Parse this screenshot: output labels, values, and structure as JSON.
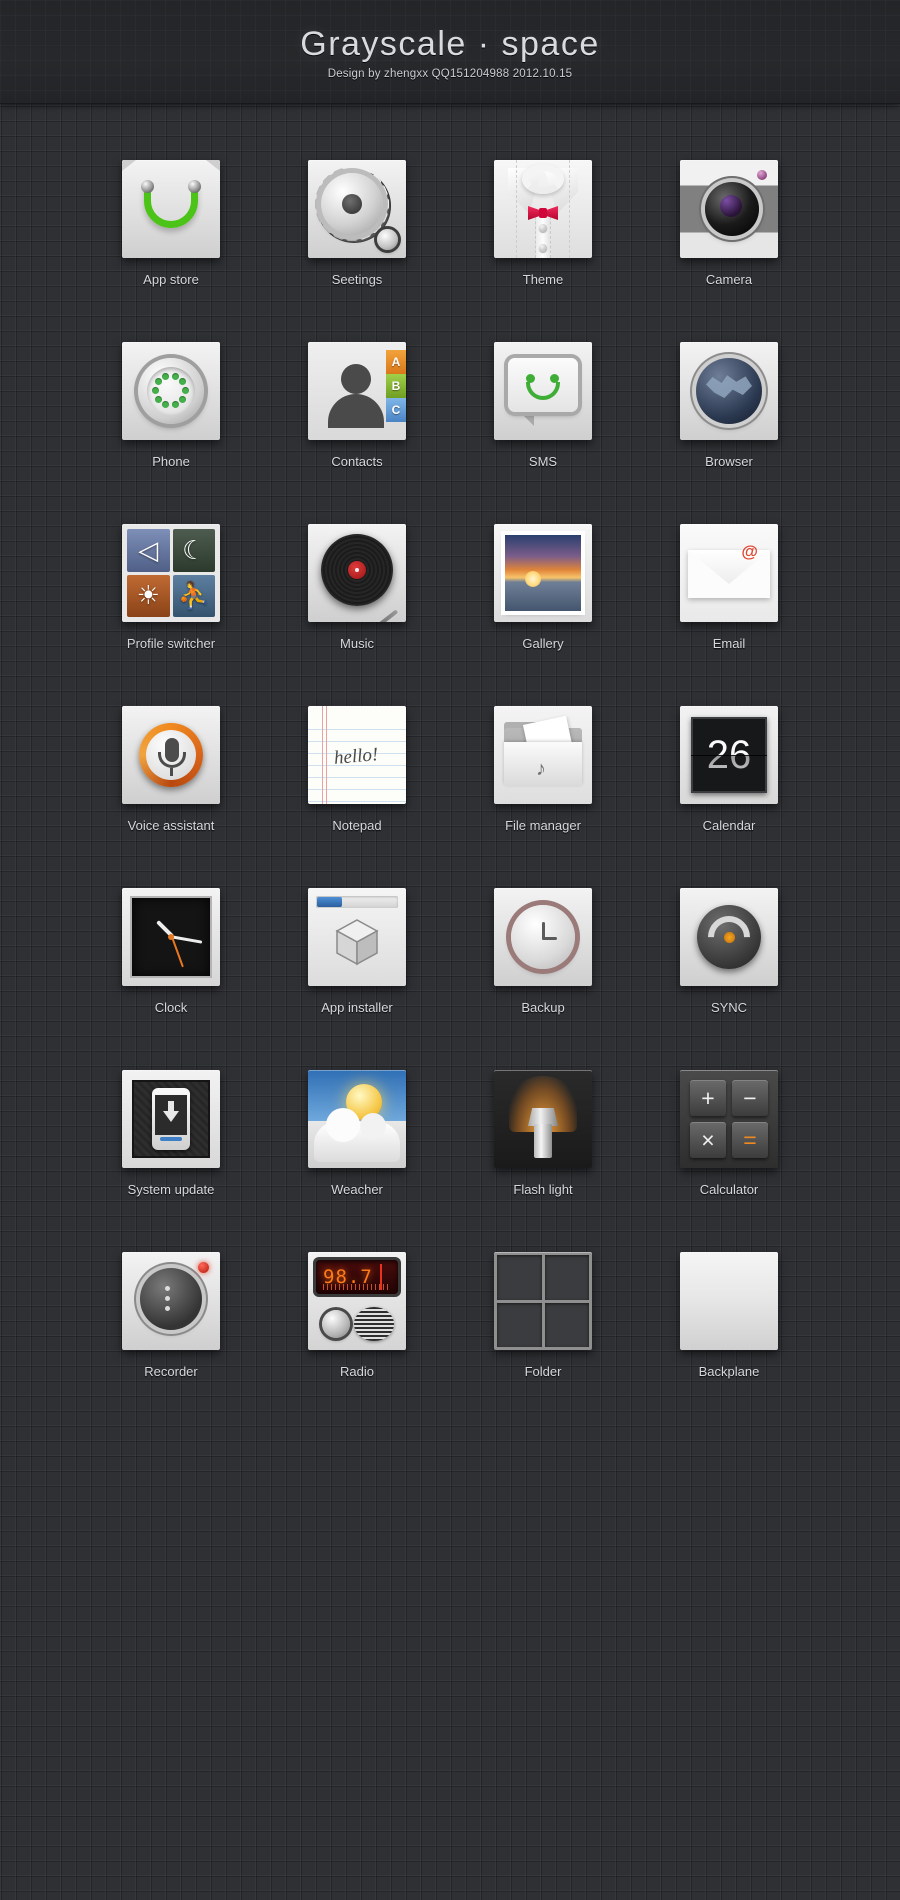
{
  "header": {
    "title": "Grayscale · space",
    "subtitle": "Design by zhengxx QQ151204988  2012.10.15"
  },
  "theme": {
    "background": "#2e3034",
    "label_color": "#d6d8dc",
    "accent_green": "#4cc417",
    "accent_orange": "#f08a20",
    "accent_red": "#d0063a",
    "accent_blue": "#3d7ec4"
  },
  "icons": [
    {
      "id": "app-store",
      "label": "App store",
      "art": "appstore"
    },
    {
      "id": "settings",
      "label": "Seetings",
      "art": "settings"
    },
    {
      "id": "theme",
      "label": "Theme",
      "art": "theme"
    },
    {
      "id": "camera",
      "label": "Camera",
      "art": "camera"
    },
    {
      "id": "phone",
      "label": "Phone",
      "art": "phone"
    },
    {
      "id": "contacts",
      "label": "Contacts",
      "art": "contacts",
      "tabs": [
        "A",
        "B",
        "C"
      ]
    },
    {
      "id": "sms",
      "label": "SMS",
      "art": "sms"
    },
    {
      "id": "browser",
      "label": "Browser",
      "art": "browser"
    },
    {
      "id": "profile-switcher",
      "label": "Profile switcher",
      "art": "profile",
      "tiles": [
        "◁",
        "☾",
        "☀",
        "🏃"
      ]
    },
    {
      "id": "music",
      "label": "Music",
      "art": "music"
    },
    {
      "id": "gallery",
      "label": "Gallery",
      "art": "gallery"
    },
    {
      "id": "email",
      "label": "Email",
      "art": "email",
      "glyph": "@"
    },
    {
      "id": "voice-assistant",
      "label": "Voice assistant",
      "art": "voice"
    },
    {
      "id": "notepad",
      "label": "Notepad",
      "art": "notepad",
      "note": "hello!"
    },
    {
      "id": "file-manager",
      "label": "File manager",
      "art": "filemanager",
      "glyph": "♪"
    },
    {
      "id": "calendar",
      "label": "Calendar",
      "art": "calendar",
      "day": "26"
    },
    {
      "id": "clock",
      "label": "Clock",
      "art": "clock"
    },
    {
      "id": "app-installer",
      "label": "App installer",
      "art": "appinstaller"
    },
    {
      "id": "backup",
      "label": "Backup",
      "art": "backup"
    },
    {
      "id": "sync",
      "label": "SYNC",
      "art": "sync"
    },
    {
      "id": "system-update",
      "label": "System update",
      "art": "systemupdate"
    },
    {
      "id": "weather",
      "label": "Weacher",
      "art": "weather"
    },
    {
      "id": "flash-light",
      "label": "Flash light",
      "art": "flashlight"
    },
    {
      "id": "calculator",
      "label": "Calculator",
      "art": "calculator",
      "keys": [
        "+",
        "−",
        "×",
        "="
      ]
    },
    {
      "id": "recorder",
      "label": "Recorder",
      "art": "recorder"
    },
    {
      "id": "radio",
      "label": "Radio",
      "art": "radio",
      "frequency": "98.7"
    },
    {
      "id": "folder",
      "label": "Folder",
      "art": "folder"
    },
    {
      "id": "backplane",
      "label": "Backplane",
      "art": "backplane"
    }
  ]
}
